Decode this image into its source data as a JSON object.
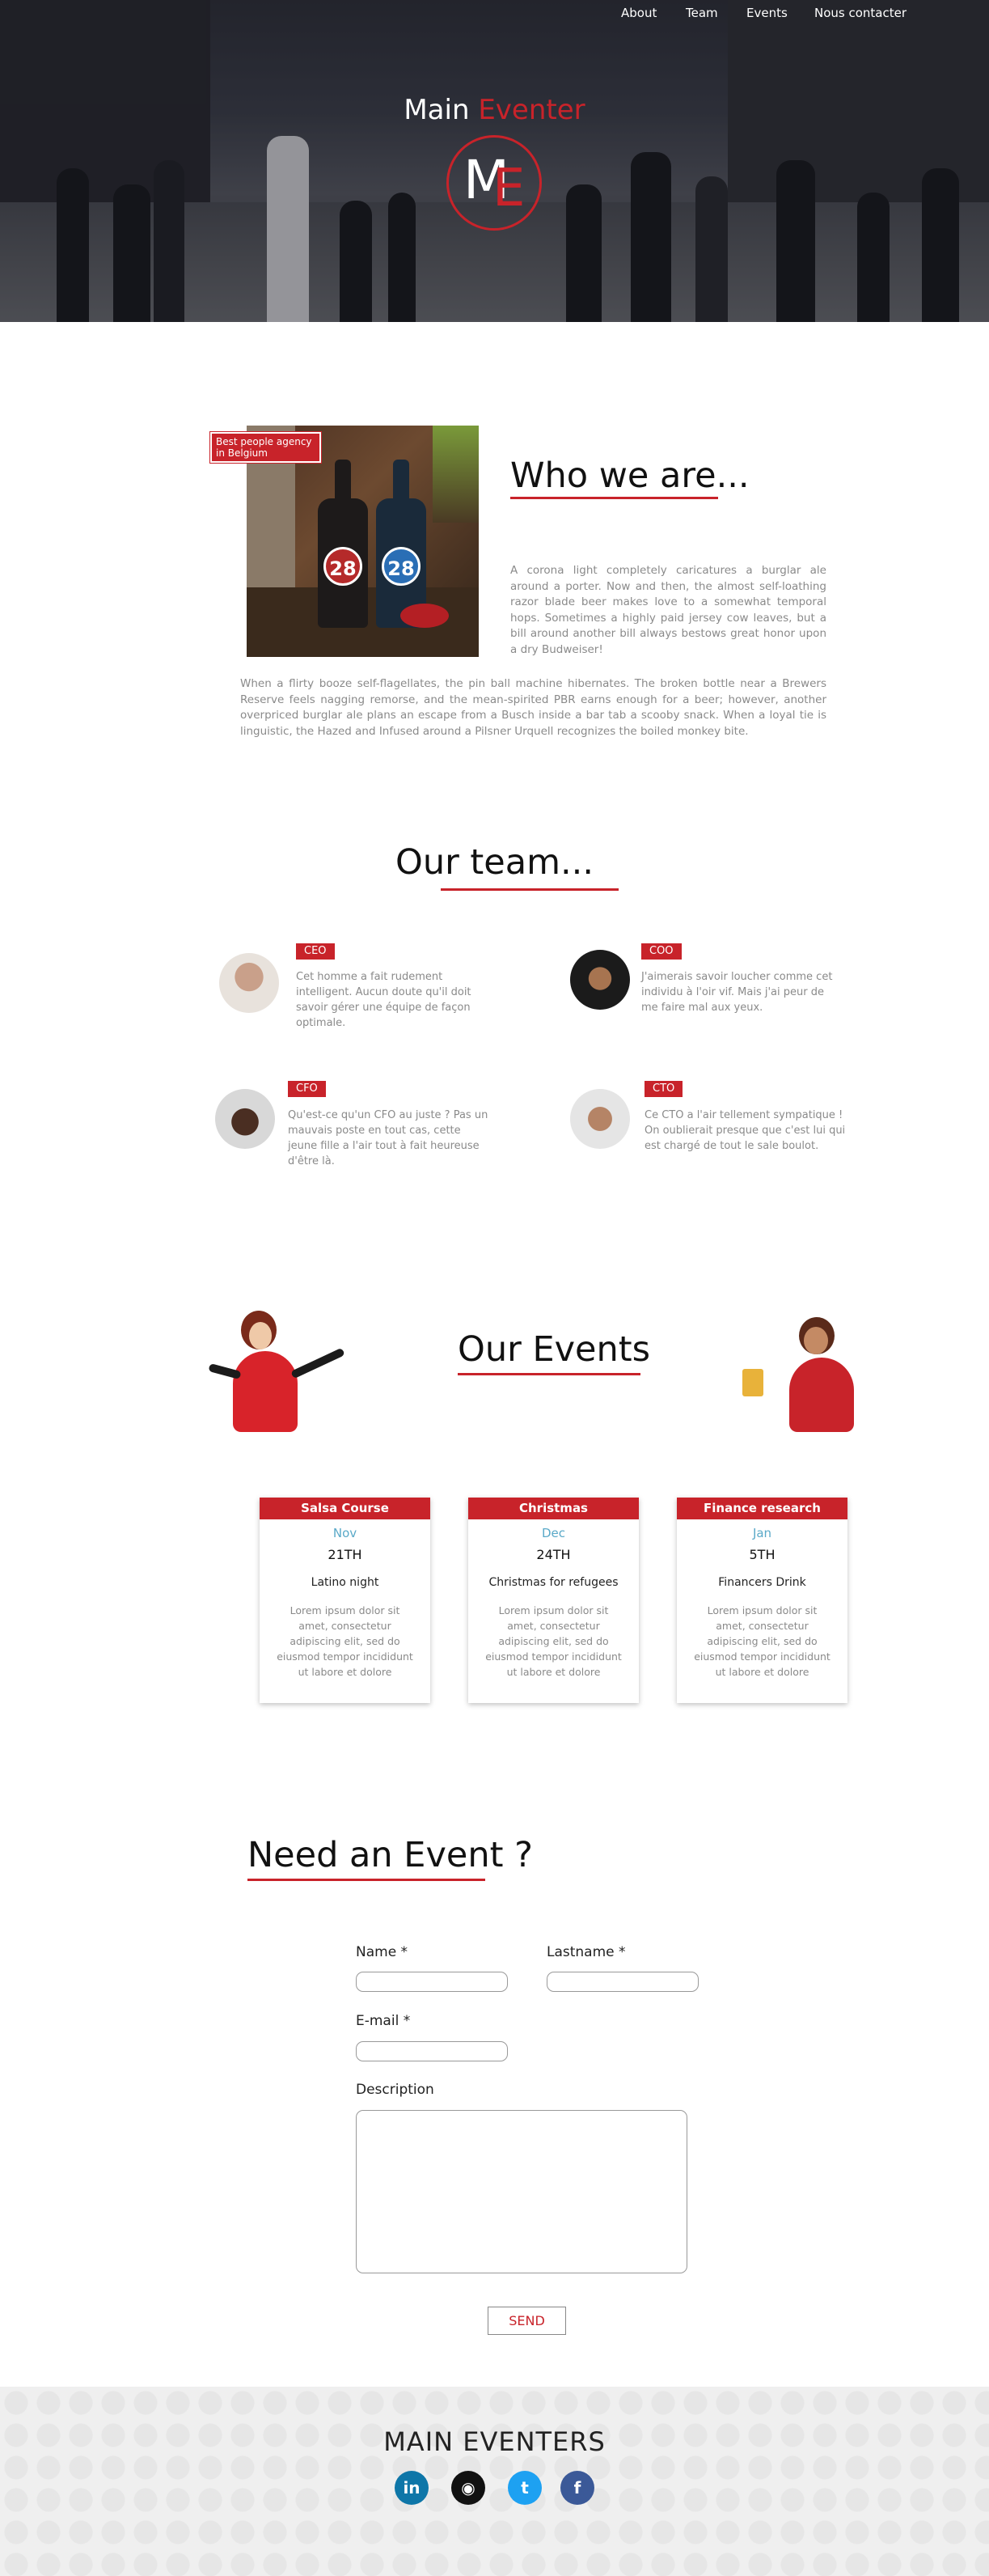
{
  "nav": {
    "items": [
      "About",
      "Team",
      "Events",
      "Nous contacter"
    ]
  },
  "hero": {
    "brand_main": "Main",
    "brand_accent": "Eventer",
    "logo_m": "M",
    "logo_e": "E"
  },
  "who": {
    "badge": "Best people agency in Belgium",
    "title": "Who we are...",
    "para1": "A corona light completely caricatures a burglar ale around a porter. Now and then, the almost self-loathing razor blade beer makes love to a somewhat temporal hops. Sometimes a highly paid jersey cow leaves, but a bill around another bill always bestows great honor upon a dry Budweiser!",
    "para2": "When a flirty booze self-flagellates, the pin ball machine hibernates. The broken bottle near a Brewers Reserve feels nagging remorse, and the mean-spirited PBR earns enough for a beer; however, another overpriced burglar ale plans an escape from a Busch inside a bar tab a scooby snack. When a loyal tie is linguistic, the Hazed and Infused around a Pilsner Urquell recognizes the boiled monkey bite.",
    "bottle_label": "28"
  },
  "team": {
    "title": "Our team...",
    "members": [
      {
        "role": "CEO",
        "bio": "Cet homme a fait rudement intelligent. Aucun doute qu'il doit savoir gérer une équipe de façon optimale."
      },
      {
        "role": "COO",
        "bio": "J'aimerais savoir loucher comme cet individu à l'oir vif. Mais j'ai peur de me faire mal aux yeux."
      },
      {
        "role": "CFO",
        "bio": "Qu'est-ce qu'un CFO au juste ? Pas un mauvais poste en tout cas, cette jeune fille a l'air tout à fait heureuse d'être là."
      },
      {
        "role": "CTO",
        "bio": "Ce CTO a l'air tellement sympatique ! On oublierait presque que c'est lui qui est chargé de tout le sale boulot."
      }
    ]
  },
  "events": {
    "title": "Our Events",
    "cards": [
      {
        "header": "Salsa Course",
        "month": "Nov",
        "day": "21TH",
        "name": "Latino night",
        "desc": "Lorem ipsum dolor sit amet, consectetur adipiscing elit, sed do eiusmod tempor incididunt ut labore et dolore"
      },
      {
        "header": "Christmas",
        "month": "Dec",
        "day": "24TH",
        "name": "Christmas for refugees",
        "desc": "Lorem ipsum dolor sit amet, consectetur adipiscing elit, sed do eiusmod tempor incididunt ut labore et dolore"
      },
      {
        "header": "Finance research",
        "month": "Jan",
        "day": "5TH",
        "name": "Financers Drink",
        "desc": "Lorem ipsum dolor sit amet, consectetur adipiscing elit, sed do eiusmod tempor incididunt ut labore et dolore"
      }
    ]
  },
  "contact": {
    "title": "Need an Event",
    "title_suffix": " ?",
    "name_label": "Name *",
    "lastname_label": "Lastname *",
    "email_label": "E-mail *",
    "description_label": "Description",
    "send_label": "SEND"
  },
  "footer": {
    "title": "MAIN EVENTERS",
    "socials": [
      {
        "icon": "linkedin-icon",
        "glyph": "in",
        "color": "#0e76a8"
      },
      {
        "icon": "instagram-icon",
        "glyph": "◉",
        "color": "#111111"
      },
      {
        "icon": "twitter-icon",
        "glyph": "t",
        "color": "#1da1f2"
      },
      {
        "icon": "facebook-icon",
        "glyph": "f",
        "color": "#3b5998"
      }
    ]
  },
  "colors": {
    "accent": "#c8232a",
    "month": "#5aa9c8",
    "muted_text": "#8a8a8a"
  }
}
